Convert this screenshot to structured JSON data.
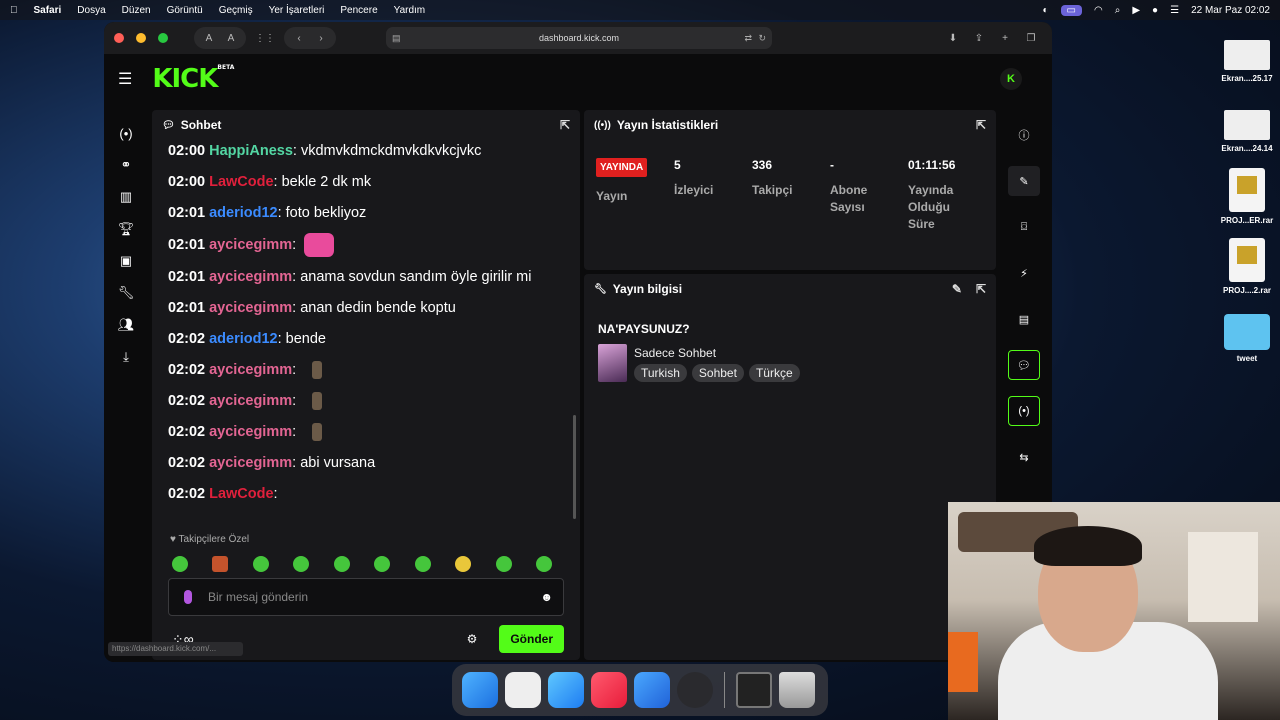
{
  "menubar": {
    "app": "Safari",
    "items": [
      "Dosya",
      "Düzen",
      "Görüntü",
      "Geçmiş",
      "Yer İşaretleri",
      "Pencere",
      "Yardım"
    ],
    "datetime": "22 Mar Paz  02:02"
  },
  "desktop": {
    "items": [
      {
        "label": "Ekran....25.17",
        "kind": "screenshot"
      },
      {
        "label": "Ekran....24.14",
        "kind": "screenshot"
      },
      {
        "label": "PROJ...ER.rar",
        "kind": "rar"
      },
      {
        "label": "PROJ....2.rar",
        "kind": "rar"
      },
      {
        "label": "tweet",
        "kind": "folder"
      }
    ]
  },
  "browser": {
    "url": "dashboard.kick.com",
    "text_small": "A",
    "text_large": "A",
    "status_url": "https://dashboard.kick.com/..."
  },
  "kick": {
    "logo": "KICK",
    "logo_badge": "BETA",
    "accent": "#53fc18"
  },
  "chat": {
    "title": "Sohbet",
    "messages": [
      {
        "time": "02:00",
        "user": "HappiAness",
        "color": "#53d6a3",
        "text": "vkdmvkdmckdmvkdkvkcjvkc"
      },
      {
        "time": "02:00",
        "user": "LawCode",
        "color": "#e0203c",
        "text": "bekle 2 dk mk"
      },
      {
        "time": "02:01",
        "user": "aderiod12",
        "color": "#3b8bff",
        "text": "foto bekliyoz"
      },
      {
        "time": "02:01",
        "user": "aycicegimm",
        "color": "#e36593",
        "text": "",
        "emote": "cat"
      },
      {
        "time": "02:01",
        "user": "aycicegimm",
        "color": "#e36593",
        "text": "anama sovdun sandım öyle girilir mi"
      },
      {
        "time": "02:01",
        "user": "aycicegimm",
        "color": "#e36593",
        "text": "anan dedin bende koptu"
      },
      {
        "time": "02:02",
        "user": "aderiod12",
        "color": "#3b8bff",
        "text": "bende"
      },
      {
        "time": "02:02",
        "user": "aycicegimm",
        "color": "#e36593",
        "text": "",
        "emote": "img"
      },
      {
        "time": "02:02",
        "user": "aycicegimm",
        "color": "#e36593",
        "text": "",
        "emote": "img"
      },
      {
        "time": "02:02",
        "user": "aycicegimm",
        "color": "#e36593",
        "text": "",
        "emote": "img"
      },
      {
        "time": "02:02",
        "user": "aycicegimm",
        "color": "#e36593",
        "text": "abi vursana"
      },
      {
        "time": "02:02",
        "user": "LawCode",
        "color": "#e0203c",
        "text": ""
      }
    ],
    "follower_label": "Takipçilere Özel",
    "input_placeholder": "Bir mesaj gönderin",
    "infinity": "∞",
    "send_label": "Gönder"
  },
  "stats": {
    "title": "Yayın İstatistikleri",
    "items": [
      {
        "value": "YAYINDA",
        "label": "Yayın",
        "live": true
      },
      {
        "value": "5",
        "label": "İzleyici"
      },
      {
        "value": "336",
        "label": "Takipçi"
      },
      {
        "value": "-",
        "label": "Abone Sayısı"
      },
      {
        "value": "01:11:56",
        "label": "Yayında Olduğu Süre"
      }
    ]
  },
  "info": {
    "title": "Yayın bilgisi",
    "stream_title": "NA'PAYSUNUZ?",
    "category": "Sadece Sohbet",
    "tags": [
      "Turkish",
      "Sohbet",
      "Türkçe"
    ]
  }
}
